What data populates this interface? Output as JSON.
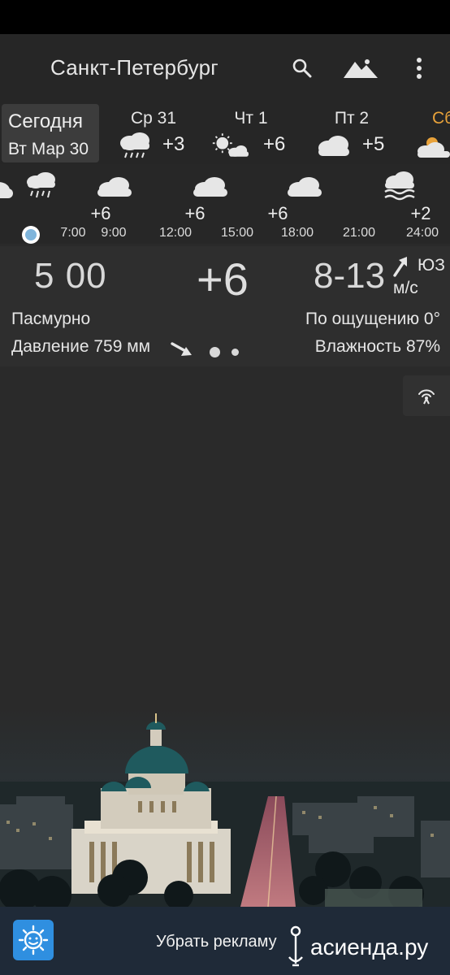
{
  "header": {
    "city": "Санкт-Петербург",
    "icons": [
      "search-icon",
      "landscape-icon",
      "more-vert-icon"
    ]
  },
  "days": {
    "today": {
      "label": "Сегодня",
      "date": "Вт Мар 30"
    },
    "items": [
      {
        "name": "Ср 31",
        "temp": "+3",
        "icon": "rain-cloud-icon"
      },
      {
        "name": "Чт 1",
        "temp": "+6",
        "icon": "sun-cloud-icon"
      },
      {
        "name": "Пт 2",
        "temp": "+5",
        "icon": "cloud-icon"
      },
      {
        "name": "Сб",
        "temp": "",
        "icon": "sun-cloud-icon"
      }
    ]
  },
  "hourly": {
    "temps": [
      "+6",
      "+6",
      "+6",
      "+2"
    ],
    "times": [
      "7:00",
      "9:00",
      "12:00",
      "15:00",
      "18:00",
      "21:00",
      "24:00"
    ]
  },
  "current": {
    "time": "5 00",
    "temp": "+6",
    "wind_speed": "8-13",
    "wind_dir": "ЮЗ",
    "wind_unit": "м/с",
    "condition": "Пасмурно",
    "feels_like": "По ощущению 0°",
    "pressure": "Давление 759 мм",
    "humidity": "Влажность 87%"
  },
  "ad": {
    "remove_label": "Убрать рекламу",
    "watermark": "асиенда.ру"
  },
  "colors": {
    "weekend": "#e8a23a",
    "now_dot": "#7fb5dc",
    "ad_bar": "#1f2a38",
    "app_logo": "#2f8fe0"
  }
}
